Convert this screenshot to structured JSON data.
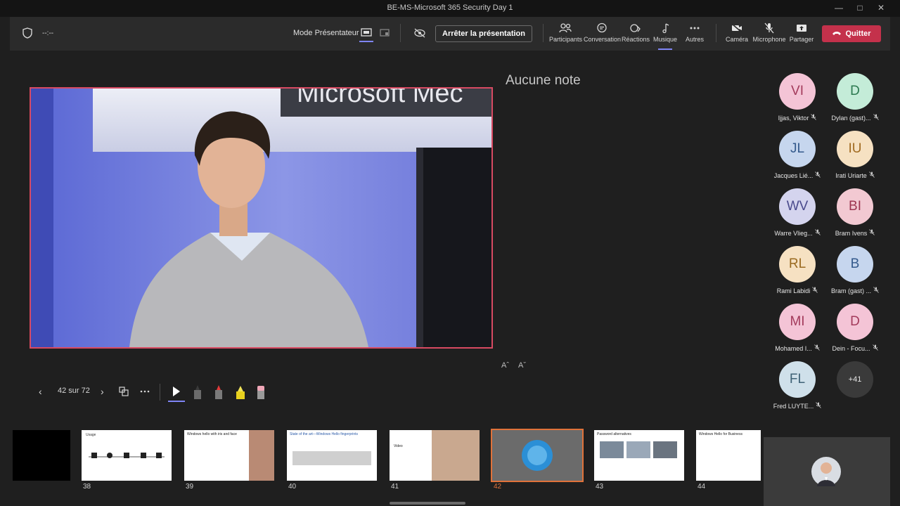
{
  "window": {
    "title": "BE-MS-Microsoft 365 Security Day 1"
  },
  "toolbar": {
    "timer": "--:--",
    "presenter_mode_label": "Mode Présentateur",
    "stop_presenting": "Arrêter la présentation",
    "items": {
      "participants": "Participants",
      "chat": "Conversation",
      "reactions": "Réactions",
      "music": "Musique",
      "more": "Autres",
      "camera": "Caméra",
      "microphone": "Microphone",
      "share": "Partager"
    },
    "quit": "Quitter"
  },
  "stage": {
    "notes_placeholder": "Aucune note",
    "slide_text": "Microsoft Mec",
    "font_increase": "Aˆ",
    "font_decrease": "Aˇ"
  },
  "slide_controls": {
    "counter": "42 sur 72"
  },
  "participants": [
    {
      "initials": "VI",
      "name": "Ijjas, Viktor",
      "bg": "#f4c4d6",
      "fg": "#a33b5c"
    },
    {
      "initials": "D",
      "name": "Dylan (gast)...",
      "bg": "#c4ecd8",
      "fg": "#2d7a51"
    },
    {
      "initials": "JL",
      "name": "Jacques Lié...",
      "bg": "#c6d6ee",
      "fg": "#345a8c"
    },
    {
      "initials": "IU",
      "name": "Irati Uriarte",
      "bg": "#f6e1c2",
      "fg": "#a06a20"
    },
    {
      "initials": "WV",
      "name": "Warre Vlieg...",
      "bg": "#d4d4ee",
      "fg": "#4a4a8c"
    },
    {
      "initials": "BI",
      "name": "Bram Ivens",
      "bg": "#f2c9d2",
      "fg": "#9c3550"
    },
    {
      "initials": "RL",
      "name": "Rami Labidi",
      "bg": "#f6e1c2",
      "fg": "#9a6a20"
    },
    {
      "initials": "B",
      "name": "Bram (gast) ...",
      "bg": "#c6d6ee",
      "fg": "#345a8c"
    },
    {
      "initials": "MI",
      "name": "Mohamed I...",
      "bg": "#f4c4d6",
      "fg": "#a33b5c"
    },
    {
      "initials": "D",
      "name": "Dein - Focu...",
      "bg": "#f4c4d6",
      "fg": "#a33b5c"
    },
    {
      "initials": "FL",
      "name": "Fred LUYTE...",
      "bg": "#cfe0ea",
      "fg": "#3f6276"
    }
  ],
  "overflow_count": "+41",
  "thumbnails": [
    {
      "num": "38",
      "title": "Usage"
    },
    {
      "num": "39",
      "title": "Windows hello with iris and face"
    },
    {
      "num": "40",
      "title": "State of the art—Windows Hello fingerprints"
    },
    {
      "num": "41",
      "title": "Video"
    },
    {
      "num": "42",
      "title": ""
    },
    {
      "num": "43",
      "title": "Password alternatives"
    },
    {
      "num": "44",
      "title": "Windows Hello for Business"
    }
  ],
  "colors": {
    "accent": "#c4314b",
    "current_slide_border": "#e0723a",
    "active_underline": "#7f85f5"
  }
}
